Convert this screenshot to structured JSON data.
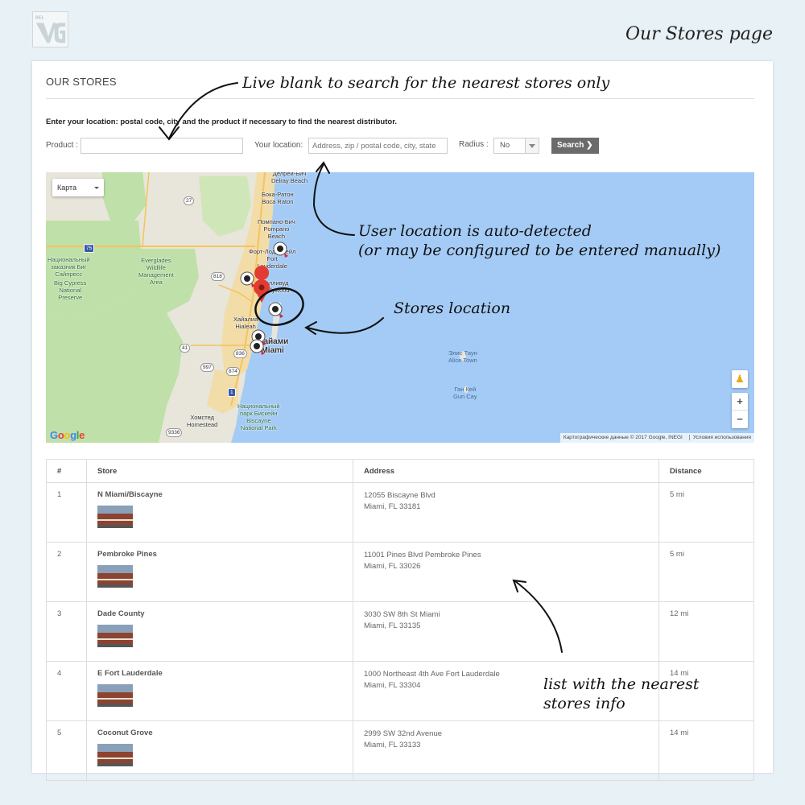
{
  "brand": {
    "logo_text": "BELVG",
    "page_caption": "Our Stores page"
  },
  "header": {
    "title": "OUR STORES"
  },
  "intro": "Enter your location: postal code, city and the product if necessary to find the nearest distributor.",
  "form": {
    "product_label": "Product :",
    "product_value": "",
    "location_label": "Your location:",
    "location_placeholder": "Address, zip / postal code, city, state",
    "radius_label": "Radius :",
    "radius_value": "No",
    "search_label": "Search ❯"
  },
  "map": {
    "type_label": "Карта",
    "google": "Google",
    "attribution": "Картографические данные © 2017 Google, INEGI",
    "terms": "Условия использования",
    "zoom_in": "+",
    "zoom_out": "−",
    "labels": {
      "delray": "Делрей-Бич\nDelray Beach",
      "boca": "Бока-Ратон\nBoca Raton",
      "pompano": "Помпано-Бич\nPompano\nBeach",
      "fortlaud": "Форт-Лодердейл\nFort\nLauderdale",
      "everglades_ru": "Национальный\nзаказник Биг\nСайпресс",
      "everglades_en": "Big Cypress\nNational\nPreserve",
      "wildlife": "Everglades\nWildlife\nManagement\nArea",
      "hollywood": "Голливуд\nHollywood",
      "hialeah": "Хайалиа\nHialeah",
      "miami": "Майами\nMiami",
      "homestead": "Хомстед\nHomestead",
      "biscayne": "Национальный\nпарк Бискейн\nBiscayne\nNational Park",
      "elbow": "Элис Таун\nAlice Town",
      "gun": "Ган Кей\nGun Cay"
    },
    "roads": [
      "27",
      "75",
      "818",
      "41",
      "836",
      "997",
      "874",
      "1",
      "9336",
      "95"
    ]
  },
  "annotations": {
    "search_hint": "Live blank to search for the nearest stores only",
    "location_hint_1": "User location is auto-detected",
    "location_hint_2": "(or may be configured to be entered manually)",
    "stores_hint": "Stores location",
    "list_hint_1": "list with the nearest",
    "list_hint_2": "stores info"
  },
  "table": {
    "headers": {
      "num": "#",
      "store": "Store",
      "address": "Address",
      "distance": "Distance"
    },
    "rows": [
      {
        "num": "1",
        "store": "N Miami/Biscayne",
        "addr1": "12055 Biscayne Blvd",
        "addr2": "Miami, FL 33181",
        "distance": "5 mi"
      },
      {
        "num": "2",
        "store": "Pembroke Pines",
        "addr1": "11001 Pines Blvd Pembroke Pines",
        "addr2": "Miami, FL 33026",
        "distance": "5 mi"
      },
      {
        "num": "3",
        "store": "Dade County",
        "addr1": "3030 SW 8th St Miami",
        "addr2": "Miami, FL 33135",
        "distance": "12 mi"
      },
      {
        "num": "4",
        "store": "E Fort Lauderdale",
        "addr1": "1000 Northeast 4th Ave Fort Lauderdale",
        "addr2": "Miami, FL 33304",
        "distance": "14 mi"
      },
      {
        "num": "5",
        "store": "Coconut Grove",
        "addr1": "2999 SW 32nd Avenue",
        "addr2": "Miami, FL 33133",
        "distance": "14 mi"
      }
    ]
  },
  "colors": {
    "water": "#a4cbf6",
    "land": "#e8e5da",
    "park": "#bfe0a8",
    "urban": "#f2dca8",
    "button": "#6b6b6b"
  }
}
